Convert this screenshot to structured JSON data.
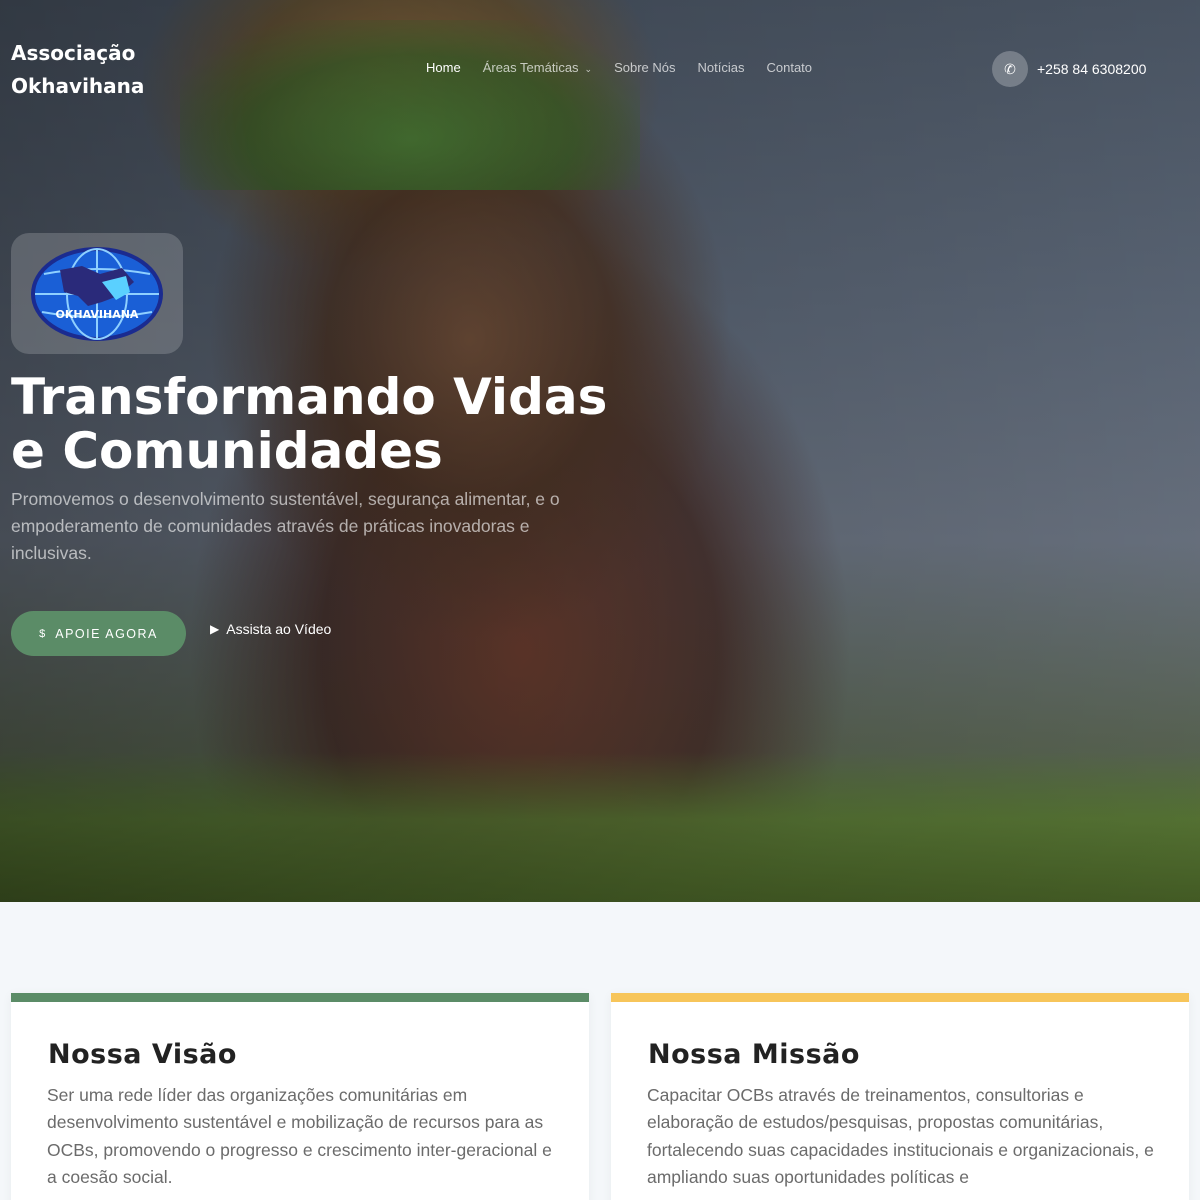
{
  "header": {
    "brand": "Associação Okhavihana",
    "nav": [
      {
        "label": "Home",
        "active": true
      },
      {
        "label": "Áreas Temáticas",
        "has_dropdown": true
      },
      {
        "label": "Sobre Nós"
      },
      {
        "label": "Notícias"
      },
      {
        "label": "Contato"
      }
    ],
    "phone_icon": "phone-icon",
    "phone": "+258 84 6308200"
  },
  "hero": {
    "logo_text": "OKHAVIHANA",
    "headline": "Transformando Vidas e Comunidades",
    "subtext": "Promovemos o desenvolvimento sustentável, segurança alimentar, e o empoderamento de comunidades através de práticas inovadoras e inclusivas.",
    "cta_icon": "dollar-icon",
    "cta_label": "APOIE AGORA",
    "video_icon": "play-icon",
    "video_label": "Assista ao Vídeo"
  },
  "cards": [
    {
      "title": "Nossa Visão",
      "text": "Ser uma rede líder das organizações comunitárias em desenvolvimento sustentável e mobilização de recursos para as OCBs, promovendo o progresso e crescimento inter-geracional e a coesão social.",
      "accent": "#5b8c67"
    },
    {
      "title": "Nossa Missão",
      "text": "Capacitar OCBs através de treinamentos, consultorias e elaboração de estudos/pesquisas, propostas comunitárias, fortalecendo suas capacidades institucionais e organizacionais, e ampliando suas oportunidades políticas e",
      "accent": "#f7c55a"
    }
  ],
  "colors": {
    "primary": "#5b8c67",
    "accent": "#f7c55a",
    "background": "#f4f7fa"
  }
}
